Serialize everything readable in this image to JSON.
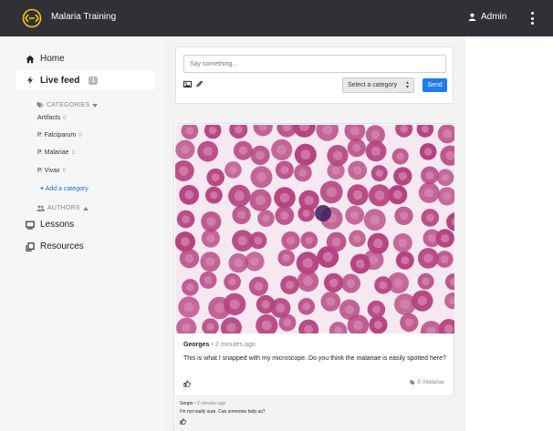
{
  "header": {
    "app_title": "Malaria Training",
    "user_label": "Admin",
    "logo_icon": "brackets-logo-icon",
    "background": "#2f3136",
    "logo_color": "#f0c419"
  },
  "sidebar": {
    "home": "Home",
    "live_feed": "Live feed",
    "live_feed_count": "1",
    "categories_heading": "CATEGORIES",
    "categories": [
      {
        "label": "Artifacts",
        "count": "0"
      },
      {
        "label": "P. Falciparum",
        "count": "0"
      },
      {
        "label": "P. Malariae",
        "count": "1"
      },
      {
        "label": "P. Vivax",
        "count": "0"
      }
    ],
    "add_category": "Add a category",
    "authors_heading": "AUTHORS",
    "lessons": "Lessons",
    "resources": "Resources"
  },
  "composer": {
    "placeholder": "Say something...",
    "category_select": "Select a category",
    "send": "Send"
  },
  "post": {
    "author": "Georges",
    "time": "2 minutes ago",
    "text": "This is what I snapped with my microscope. Do you think the malariae is easily spotted here?",
    "tag": "P. Malariae",
    "comment": {
      "author": "Sergio",
      "time": "2 minutes ago",
      "text": "I'm not really sure. Can someone help us?"
    }
  },
  "colors": {
    "accent": "#1e7af0",
    "cell": "#b5427f",
    "cell_center": "#d68bb3"
  }
}
